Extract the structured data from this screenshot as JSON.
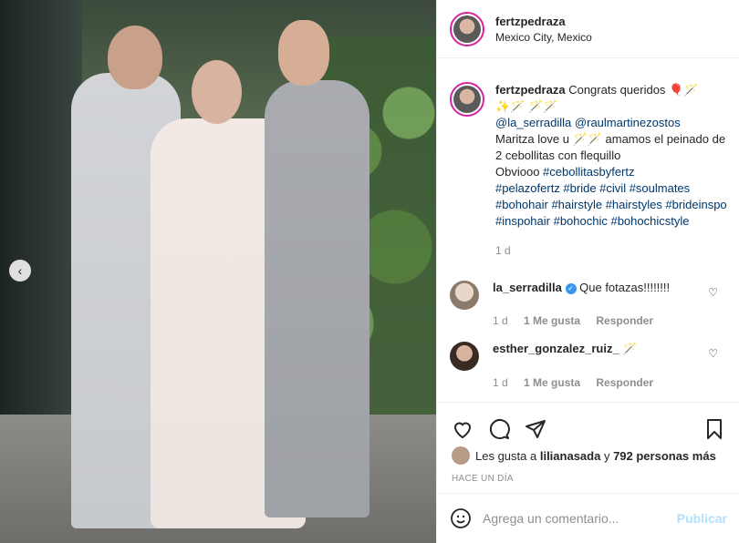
{
  "post": {
    "username": "fertzpedraza",
    "location": "Mexico City, Mexico"
  },
  "caption": {
    "username": "fertzpedraza",
    "line1": "Congrats queridos 🎈🪄",
    "line1b": "✨🪄 🪄🪄",
    "mentions": [
      "@la_serradilla",
      "@raulmartinezostos"
    ],
    "text1": "Maritza love u 🪄🪄 amamos el peinado de 2 cebollitas con flequillo",
    "text2": "Obviooo",
    "hashtags": "#cebollitasbyfertz #pelazofertz #bride #civil #soulmates #bohohair #hairstyle #hairstyles #brideinspo #inspohair #bohochic #bohochicstyle",
    "hashtag_first": "#cebollitasbyfertz",
    "hashtags_rest": "#pelazofertz #bride #civil #soulmates #bohohair #hairstyle #hairstyles #brideinspo #inspohair #bohochic #bohochicstyle",
    "age": "1 d"
  },
  "comments": [
    {
      "username": "la_serradilla",
      "text": "Que fotazas!!!!!!!!",
      "age": "1 d",
      "likes": "1 Me gusta",
      "reply": "Responder"
    },
    {
      "username": "esther_gonzalez_ruiz_",
      "text": "🪄",
      "age": "1 d",
      "likes": "1 Me gusta",
      "reply": "Responder"
    }
  ],
  "likes": {
    "prefix": "Les gusta a ",
    "user": "lilianasada",
    "mid": " y ",
    "count": "792 personas más"
  },
  "timestamp": "HACE UN DÍA",
  "add_comment": {
    "placeholder": "Agrega un comentario...",
    "publish": "Publicar"
  },
  "colors": {
    "link": "#00376b",
    "verified": "#3897f0",
    "publish_disabled": "#b2dffc",
    "story_ring": "#d6249f"
  },
  "icons": [
    "chevron-left-icon",
    "heart-icon",
    "comment-icon",
    "share-icon",
    "bookmark-icon",
    "emoji-icon",
    "verified-icon"
  ]
}
